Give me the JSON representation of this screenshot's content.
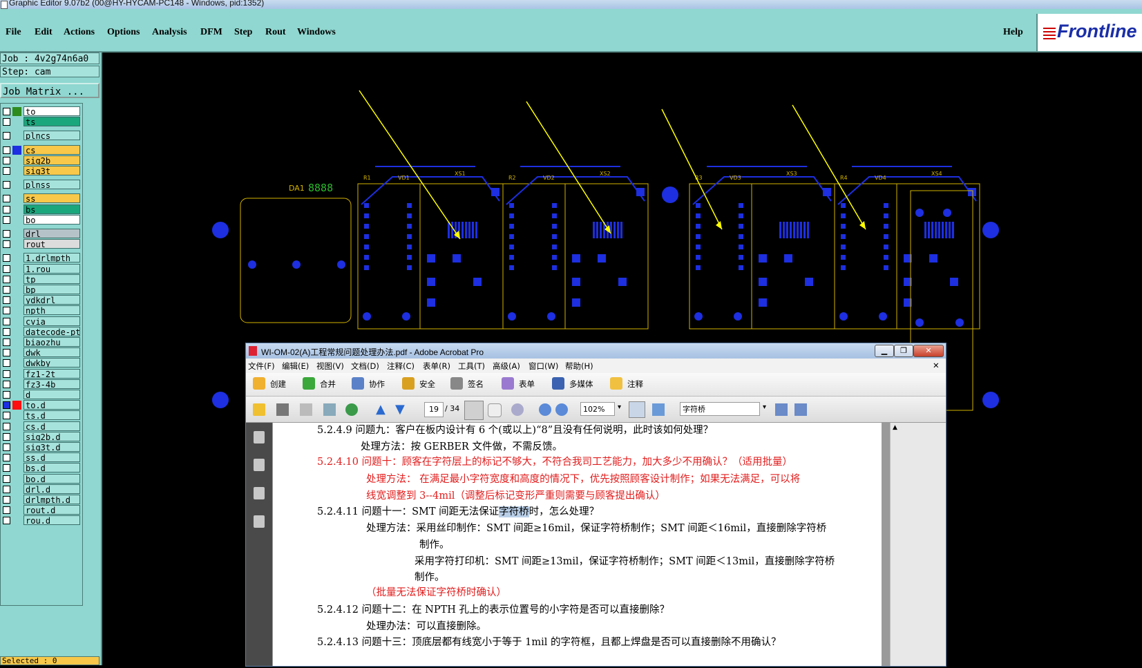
{
  "window": {
    "title": "Graphic Editor 9.07b2 (00@HY-HYCAM-PC148 - Windows, pid:1352)"
  },
  "menu": {
    "items": [
      "File",
      "Edit",
      "Actions",
      "Options",
      "Analysis",
      "DFM",
      "Step",
      "Rout",
      "Windows"
    ],
    "help": "Help",
    "logo": "Frontline"
  },
  "job": {
    "job_label": "Job : 4v2g74n6a0",
    "step_label": "Step: cam",
    "matrix_button": "Job Matrix ..."
  },
  "layers": [
    {
      "name": "to",
      "swatch": "#2e8b1e",
      "bg": "#ffffff"
    },
    {
      "name": "ts",
      "swatch": "",
      "bg": "#1aa77c"
    },
    {
      "name": "plncs",
      "swatch": "",
      "bg": "#a6e3dc"
    },
    {
      "name": "cs",
      "swatch": "#1d2fe0",
      "bg": "#f7c84a"
    },
    {
      "name": "sig2b",
      "swatch": "",
      "bg": "#f7c84a"
    },
    {
      "name": "sig3t",
      "swatch": "",
      "bg": "#f7c84a"
    },
    {
      "name": "plnss",
      "swatch": "",
      "bg": "#a6e3dc"
    },
    {
      "name": "ss",
      "swatch": "",
      "bg": "#f7c84a"
    },
    {
      "name": "bs",
      "swatch": "",
      "bg": "#1aa77c"
    },
    {
      "name": "bo",
      "swatch": "",
      "bg": "#ffffff"
    },
    {
      "name": "drl",
      "swatch": "",
      "bg": "#b5c3c8"
    },
    {
      "name": "rout",
      "swatch": "",
      "bg": "#dcdcdc"
    },
    {
      "name": "1.drlmpth",
      "swatch": "",
      "bg": "#a6e3dc"
    },
    {
      "name": "1.rou",
      "swatch": "",
      "bg": "#a6e3dc"
    },
    {
      "name": "tp",
      "swatch": "",
      "bg": "#a6e3dc"
    },
    {
      "name": "bp",
      "swatch": "",
      "bg": "#a6e3dc"
    },
    {
      "name": "ydkdrl",
      "swatch": "",
      "bg": "#a6e3dc"
    },
    {
      "name": "npth",
      "swatch": "",
      "bg": "#a6e3dc"
    },
    {
      "name": "cvia",
      "swatch": "",
      "bg": "#a6e3dc"
    },
    {
      "name": "datecode-pt",
      "swatch": "",
      "bg": "#a6e3dc"
    },
    {
      "name": "biaozhu",
      "swatch": "",
      "bg": "#a6e3dc"
    },
    {
      "name": "dwk",
      "swatch": "",
      "bg": "#a6e3dc"
    },
    {
      "name": "dwkby",
      "swatch": "",
      "bg": "#a6e3dc"
    },
    {
      "name": "fz1-2t",
      "swatch": "",
      "bg": "#a6e3dc"
    },
    {
      "name": "fz3-4b",
      "swatch": "",
      "bg": "#a6e3dc"
    },
    {
      "name": "d",
      "swatch": "",
      "bg": "#a6e3dc"
    },
    {
      "name": "to.d",
      "swatch": "#ff1010",
      "bg": "#a6e3dc",
      "checked": true
    },
    {
      "name": "ts.d",
      "swatch": "",
      "bg": "#a6e3dc"
    },
    {
      "name": "cs.d",
      "swatch": "",
      "bg": "#a6e3dc"
    },
    {
      "name": "sig2b.d",
      "swatch": "",
      "bg": "#a6e3dc"
    },
    {
      "name": "sig3t.d",
      "swatch": "",
      "bg": "#a6e3dc"
    },
    {
      "name": "ss.d",
      "swatch": "",
      "bg": "#a6e3dc"
    },
    {
      "name": "bs.d",
      "swatch": "",
      "bg": "#a6e3dc"
    },
    {
      "name": "bo.d",
      "swatch": "",
      "bg": "#a6e3dc"
    },
    {
      "name": "drl.d",
      "swatch": "",
      "bg": "#a6e3dc"
    },
    {
      "name": "drlmpth.d",
      "swatch": "",
      "bg": "#a6e3dc"
    },
    {
      "name": "rout.d",
      "swatch": "",
      "bg": "#a6e3dc"
    },
    {
      "name": "rou.d",
      "swatch": "",
      "bg": "#a6e3dc"
    }
  ],
  "status": {
    "selected": "Selected : 0"
  },
  "pcb": {
    "labels": [
      "DA1",
      "XS1",
      "XS2",
      "XS3",
      "XS4",
      "VD1",
      "VD2",
      "VD3",
      "VD4",
      "R1",
      "R2",
      "R3",
      "R4"
    ],
    "counter": "8888",
    "colors": {
      "outline": "#d4b400",
      "copper": "#1d2fe0",
      "arrow": "#ffff00"
    }
  },
  "acrobat": {
    "title": "WI-OM-02(A)工程常规问题处理办法.pdf - Adobe Acrobat Pro",
    "menu": [
      "文件(F)",
      "编辑(E)",
      "视图(V)",
      "文档(D)",
      "注释(C)",
      "表单(R)",
      "工具(T)",
      "高级(A)",
      "窗口(W)",
      "帮助(H)"
    ],
    "toolbar1": [
      "创建",
      "合并",
      "协作",
      "安全",
      "签名",
      "表单",
      "多媒体",
      "注释"
    ],
    "page": "19",
    "page_total": "/ 34",
    "zoom": "102%",
    "search": "字符桥",
    "doc": {
      "l1": "5.2.4.9  问题九：客户在板内设计有 6 个(或以上)“8”且没有任何说明，此时该如何处理？",
      "l2": "处理方法：按 GERBER 文件做，不需反馈。",
      "l3": "5.2.4.10  问题十：顾客在字符层上的标记不够大，不符合我司工艺能力，加大多少不用确认？（适用批量）",
      "l4": "处理方法：  在满足最小字符宽度和高度的情况下，优先按照顾客设计制作；如果无法满足，可以将",
      "l5": "线宽调整到 3--4mil（调整后标记变形严重则需要与顾客提出确认）",
      "l6a": "5.2.4.11  问题十一：SMT 间距无法保证",
      "l6b": "字符桥",
      "l6c": "时，怎么处理？",
      "l7": "处理方法：采用丝印制作：SMT 间距≥16mil，保证字符桥制作；SMT 间距＜16mil，直接删除字符桥",
      "l8": "制作。",
      "l9": "采用字符打印机：SMT 间距≥13mil，保证字符桥制作；SMT 间距＜13mil，直接删除字符桥",
      "l10": "制作。",
      "l11": "（批量无法保证字符桥时确认）",
      "l12": "5.2.4.12  问题十二：在 NPTH 孔上的表示位置号的小字符是否可以直接删除？",
      "l13": "处理办法：可以直接删除。",
      "l14": "5.2.4.13  问题十三：顶底层都有线宽小于等于 1mil 的字符框，且都上焊盘是否可以直接删除不用确认？"
    }
  }
}
